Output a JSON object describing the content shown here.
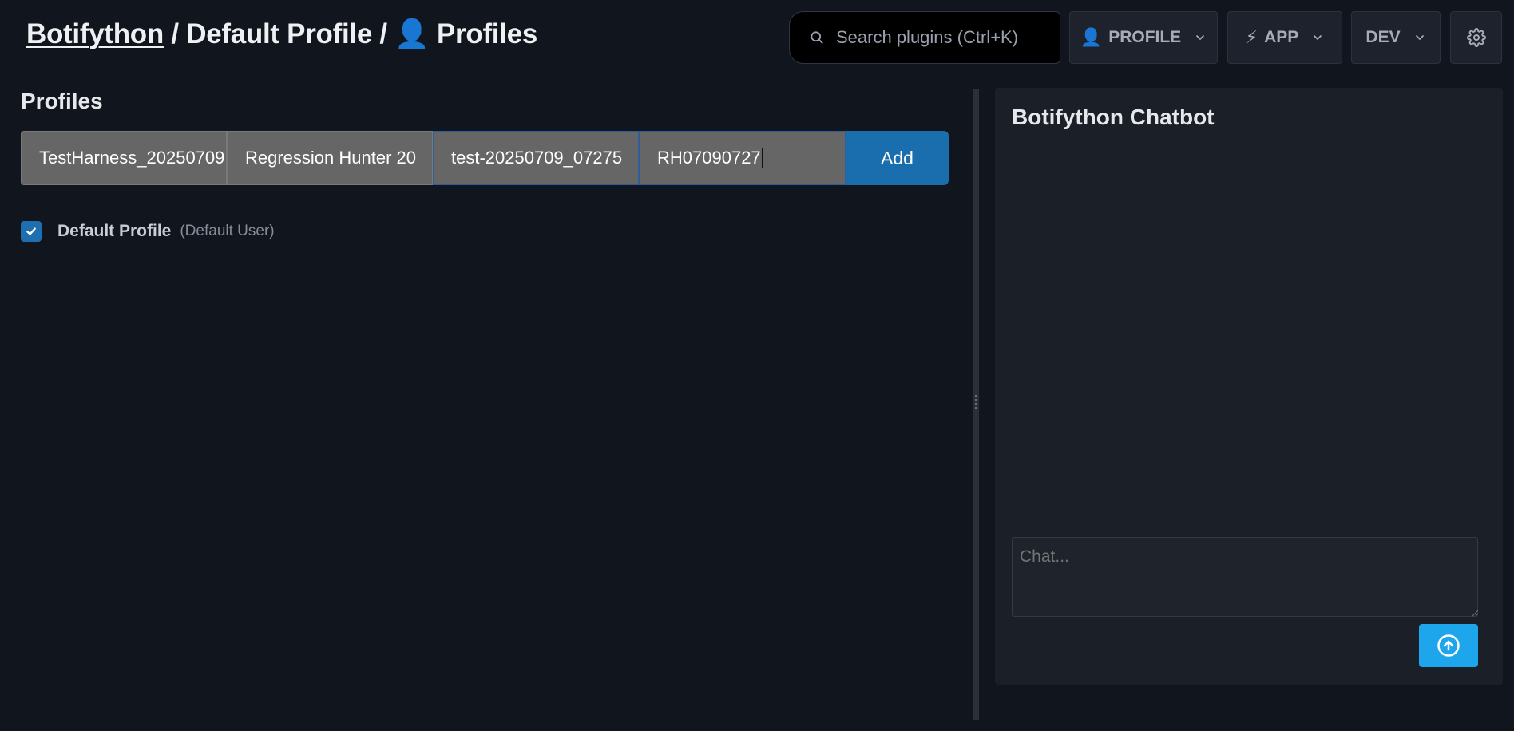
{
  "header": {
    "breadcrumb": {
      "root": "Botifython",
      "sep1": " / ",
      "profile": "Default Profile",
      "sep2": " / ",
      "page_emoji": "👤",
      "page": "Profiles"
    },
    "search": {
      "placeholder": "Search plugins (Ctrl+K)",
      "icon": "search-icon"
    },
    "profile_menu": {
      "emoji": "👤",
      "label": "PROFILE"
    },
    "app_menu": {
      "emoji": "⚡",
      "label": "APP"
    },
    "dev_menu": {
      "label": "DEV"
    },
    "settings": {
      "icon": "gear-icon"
    }
  },
  "profiles": {
    "title": "Profiles",
    "form": {
      "name_value": "TestHarness_20250709",
      "real_name_value": "Regression Hunter 20",
      "address_value": "test-20250709_07275",
      "code_value": "RH07090727",
      "add_label": "Add"
    },
    "list": [
      {
        "name": "Default Profile",
        "sub": "(Default User)",
        "checked": true
      }
    ]
  },
  "chat": {
    "title": "Botifython Chatbot",
    "placeholder": "Chat...",
    "send_icon": "arrow-up-circle-icon",
    "accent": "#1ea6ec"
  },
  "colors": {
    "background": "#11151d",
    "panel": "#1b1f27",
    "add_button": "#1a6ead",
    "checkbox": "#1f6fb0"
  }
}
